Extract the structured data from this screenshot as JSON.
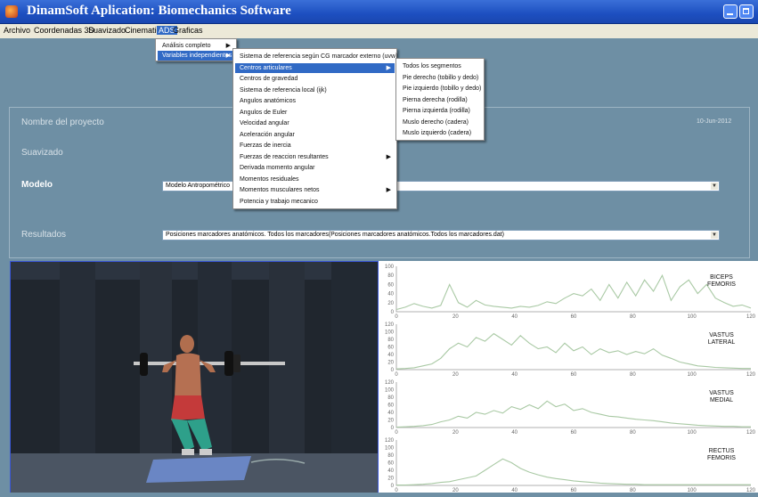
{
  "window": {
    "title": "DinamSoft Aplication: Biomechanics Software"
  },
  "menubar": {
    "items": [
      "Archivo",
      "Coordenadas 3D",
      "Suavizado",
      "Cinematica",
      "ADS",
      "Graficas"
    ]
  },
  "ads_menu": {
    "items": [
      {
        "label": "Análisis completo",
        "submenu": true
      },
      {
        "label": "Variables independientes",
        "submenu": true
      }
    ]
  },
  "variables_menu": {
    "items": [
      {
        "label": "Sistema de referencia según CG marcador externo (uvw)",
        "submenu": false
      },
      {
        "label": "Centros articulares",
        "submenu": true
      },
      {
        "label": "Centros de gravedad",
        "submenu": false
      },
      {
        "label": "Sistema de referencia local (ijk)",
        "submenu": false
      },
      {
        "label": "Angulos anatómicos",
        "submenu": false
      },
      {
        "label": "Angulos de Euler",
        "submenu": false
      },
      {
        "label": "Velocidad angular",
        "submenu": false
      },
      {
        "label": "Aceleración angular",
        "submenu": false
      },
      {
        "label": "Fuerzas de inercia",
        "submenu": false
      },
      {
        "label": "Fuerzas de reaccion resultantes",
        "submenu": true
      },
      {
        "label": "Derivada momento angular",
        "submenu": false
      },
      {
        "label": "Momentos residuales",
        "submenu": false
      },
      {
        "label": "Momentos musculares netos",
        "submenu": true
      },
      {
        "label": "Potencia y trabajo mecanico",
        "submenu": false
      }
    ]
  },
  "centros_menu": {
    "items": [
      "Todos los segmentos",
      "Pie derecho (tobillo y dedo)",
      "Pie izquierdo (tobillo y dedo)",
      "Pierna derecha (rodilla)",
      "Pierna izquierda (rodilla)",
      "Muslo derecho (cadera)",
      "Muslo izquierdo (cadera)"
    ]
  },
  "form": {
    "project_label": "Nombre del proyecto",
    "date": "10-Jun-2012",
    "suavizado_label": "Suavizado",
    "modelo_label": "Modelo",
    "modelo_value": "Modelo Antropométrico",
    "resultados_label": "Resultados",
    "resultados_value": "Posiciones marcadores anatómicos.   Todos los marcadores(Posiciones marcadores anatómicos.Todos los marcadores.dat)"
  },
  "icons": {
    "dropdown": "dropdown-arrow-icon",
    "submenu": "submenu-arrow-icon",
    "app": "app-icon"
  },
  "colors": {
    "titlebar": "#1d4fc0",
    "highlight": "#316ac5",
    "background": "#6e8fa4",
    "emg_line": "#a9c9a4"
  },
  "chart_data": [
    {
      "type": "line",
      "title": "",
      "annotation": "BICEPS FEMORIS",
      "x_ticks": [
        "0",
        "20",
        "40",
        "60",
        "80",
        "100",
        "120"
      ],
      "y_ticks": [
        "0",
        "20",
        "40",
        "60",
        "80",
        "100"
      ],
      "xlim": [
        0,
        120
      ],
      "ylim": [
        0,
        100
      ],
      "x": [
        0,
        3,
        6,
        9,
        12,
        15,
        18,
        21,
        24,
        27,
        30,
        33,
        36,
        39,
        42,
        45,
        48,
        51,
        54,
        57,
        60,
        63,
        66,
        69,
        72,
        75,
        78,
        81,
        84,
        87,
        90,
        93,
        96,
        99,
        102,
        105,
        108,
        111,
        114,
        117,
        120
      ],
      "y": [
        5,
        10,
        18,
        12,
        8,
        14,
        60,
        20,
        10,
        25,
        15,
        12,
        10,
        8,
        12,
        10,
        14,
        22,
        18,
        30,
        40,
        35,
        50,
        25,
        60,
        30,
        65,
        35,
        70,
        45,
        80,
        25,
        55,
        70,
        40,
        60,
        30,
        20,
        12,
        15,
        8
      ]
    },
    {
      "type": "line",
      "title": "",
      "annotation": "VASTUS LATERAL",
      "x_ticks": [
        "0",
        "20",
        "40",
        "60",
        "80",
        "100",
        "120"
      ],
      "y_ticks": [
        "0",
        "20",
        "40",
        "60",
        "80",
        "100",
        "120"
      ],
      "xlim": [
        0,
        120
      ],
      "ylim": [
        0,
        120
      ],
      "x": [
        0,
        3,
        6,
        9,
        12,
        15,
        18,
        21,
        24,
        27,
        30,
        33,
        36,
        39,
        42,
        45,
        48,
        51,
        54,
        57,
        60,
        63,
        66,
        69,
        72,
        75,
        78,
        81,
        84,
        87,
        90,
        93,
        96,
        99,
        102,
        105,
        108,
        111,
        114,
        117,
        120
      ],
      "y": [
        2,
        3,
        5,
        10,
        15,
        30,
        55,
        70,
        60,
        85,
        75,
        95,
        80,
        65,
        90,
        70,
        55,
        60,
        45,
        70,
        50,
        60,
        40,
        55,
        45,
        50,
        40,
        48,
        42,
        55,
        38,
        30,
        20,
        15,
        10,
        8,
        6,
        5,
        4,
        3,
        3
      ]
    },
    {
      "type": "line",
      "title": "",
      "annotation": "VASTUS MEDIAL",
      "x_ticks": [
        "0",
        "20",
        "40",
        "60",
        "80",
        "100",
        "120"
      ],
      "y_ticks": [
        "0",
        "20",
        "40",
        "60",
        "80",
        "100",
        "120"
      ],
      "xlim": [
        0,
        120
      ],
      "ylim": [
        0,
        120
      ],
      "x": [
        0,
        3,
        6,
        9,
        12,
        15,
        18,
        21,
        24,
        27,
        30,
        33,
        36,
        39,
        42,
        45,
        48,
        51,
        54,
        57,
        60,
        63,
        66,
        69,
        72,
        75,
        78,
        81,
        84,
        87,
        90,
        93,
        96,
        99,
        102,
        105,
        108,
        111,
        114,
        117,
        120
      ],
      "y": [
        1,
        2,
        3,
        5,
        8,
        15,
        20,
        30,
        25,
        40,
        35,
        45,
        38,
        55,
        48,
        60,
        50,
        70,
        55,
        62,
        45,
        50,
        40,
        35,
        30,
        28,
        25,
        22,
        20,
        18,
        15,
        12,
        10,
        8,
        6,
        5,
        4,
        3,
        3,
        2,
        2
      ]
    },
    {
      "type": "line",
      "title": "",
      "annotation": "RECTUS FEMORIS",
      "x_ticks": [
        "0",
        "20",
        "40",
        "60",
        "80",
        "100",
        "120"
      ],
      "y_ticks": [
        "0",
        "20",
        "40",
        "60",
        "80",
        "100",
        "120"
      ],
      "xlim": [
        0,
        120
      ],
      "ylim": [
        0,
        120
      ],
      "x": [
        0,
        3,
        6,
        9,
        12,
        15,
        18,
        21,
        24,
        27,
        30,
        33,
        36,
        39,
        42,
        45,
        48,
        51,
        54,
        57,
        60,
        63,
        66,
        69,
        72,
        75,
        78,
        81,
        84,
        87,
        90,
        93,
        96,
        99,
        102,
        105,
        108,
        111,
        114,
        117,
        120
      ],
      "y": [
        1,
        1,
        2,
        3,
        5,
        8,
        10,
        15,
        20,
        25,
        40,
        55,
        70,
        60,
        45,
        35,
        28,
        22,
        18,
        15,
        12,
        10,
        8,
        6,
        5,
        4,
        3,
        3,
        2,
        2,
        2,
        2,
        2,
        2,
        2,
        2,
        2,
        2,
        2,
        2,
        2
      ]
    }
  ]
}
